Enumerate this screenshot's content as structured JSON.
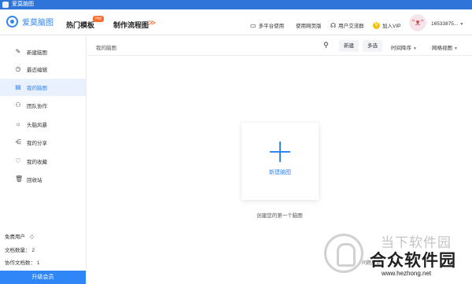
{
  "window": {
    "title": "爱莫脑图"
  },
  "header": {
    "logo_text": "爱莫脑图",
    "nav": [
      {
        "label": "热门模板",
        "badge": "Hot"
      },
      {
        "label": "制作流程图"
      }
    ],
    "nav_arrows": "≫",
    "links": [
      {
        "label": "多平台使用",
        "icon": "monitor-icon"
      },
      {
        "label": "使用网页版",
        "icon": ""
      },
      {
        "label": "用户交流群",
        "icon": "headset-icon"
      },
      {
        "label": "加入VIP",
        "icon": "vip-crown-icon"
      }
    ],
    "username": "16533875...",
    "avatar_icon": "rabbit-avatar"
  },
  "sidebar": {
    "items": [
      {
        "label": "新建脑图",
        "icon": "edit-icon",
        "active": false
      },
      {
        "label": "最近编辑",
        "icon": "clock-icon",
        "active": false
      },
      {
        "label": "我的脑图",
        "icon": "file-icon",
        "active": true
      },
      {
        "label": "团队协作",
        "icon": "team-icon",
        "active": false
      },
      {
        "label": "头脑风暴",
        "icon": "bulb-icon",
        "active": false
      },
      {
        "label": "我的分享",
        "icon": "share-icon",
        "active": false
      },
      {
        "label": "我的收藏",
        "icon": "heart-icon",
        "active": false
      },
      {
        "label": "回收站",
        "icon": "trash-icon",
        "active": false
      }
    ],
    "user_type": "免费用户",
    "doc_count_label": "文档数量：",
    "doc_count": "2",
    "collab_count_label": "协作文档数：",
    "collab_count": "1",
    "upgrade_label": "升级会员"
  },
  "toolbar": {
    "breadcrumb": "我的脑图",
    "new_label": "新建",
    "multi_select_label": "多选",
    "sort_label": "时间降序",
    "view_label": "网格视图"
  },
  "main": {
    "new_card_label": "新建脑图",
    "hint": "创建您的第一个脑图"
  },
  "watermark": {
    "line1": "当下软件园",
    "line2": "合众软件园",
    "url": "www.hezhong.net",
    "feedback": "问题反馈"
  },
  "colors": {
    "accent": "#2f86f6",
    "titlebar": "#2f74d8",
    "hot_badge": "#ff6b2c",
    "active_bg": "#e8f1fd"
  }
}
